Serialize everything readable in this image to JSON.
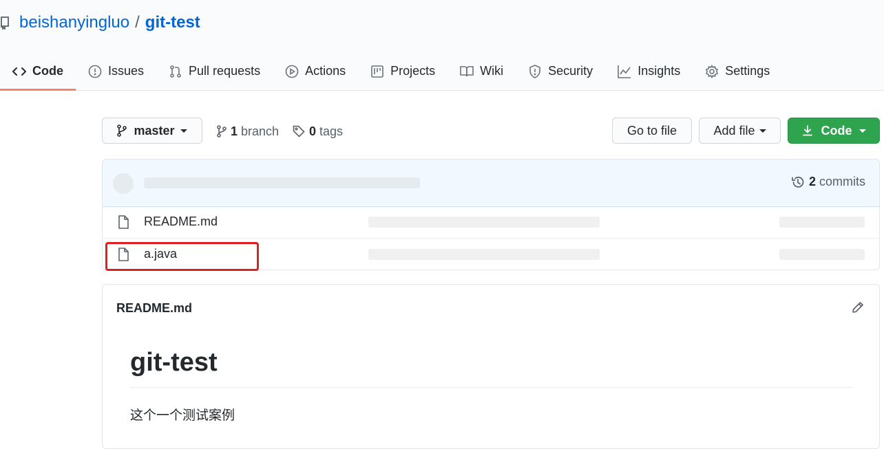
{
  "repo": {
    "owner": "beishanyingluo",
    "separator": "/",
    "name": "git-test"
  },
  "tabs": [
    {
      "label": "Code",
      "icon": "code-icon",
      "selected": true
    },
    {
      "label": "Issues",
      "icon": "issue-opened-icon"
    },
    {
      "label": "Pull requests",
      "icon": "git-pull-request-icon"
    },
    {
      "label": "Actions",
      "icon": "play-icon"
    },
    {
      "label": "Projects",
      "icon": "project-icon"
    },
    {
      "label": "Wiki",
      "icon": "book-icon"
    },
    {
      "label": "Security",
      "icon": "shield-icon"
    },
    {
      "label": "Insights",
      "icon": "graph-icon"
    },
    {
      "label": "Settings",
      "icon": "gear-icon"
    }
  ],
  "toolbar": {
    "branch_select": "master",
    "branch_count": "1",
    "branch_label": "branch",
    "tag_count": "0",
    "tag_label": "tags",
    "go_to_file": "Go to file",
    "add_file": "Add file",
    "code_button": "Code"
  },
  "commit_bar": {
    "commit_count": "2",
    "commit_label": "commits"
  },
  "files": [
    {
      "name": "README.md",
      "icon": "file-icon"
    },
    {
      "name": "a.java",
      "icon": "file-icon"
    }
  ],
  "readme": {
    "header": "README.md",
    "heading": "git-test",
    "paragraph": "这个一个测试案例"
  },
  "colors": {
    "link": "#0366d6",
    "accent_underline": "#f9826c",
    "green_button": "#2ea44f",
    "highlight": "#e02020"
  }
}
